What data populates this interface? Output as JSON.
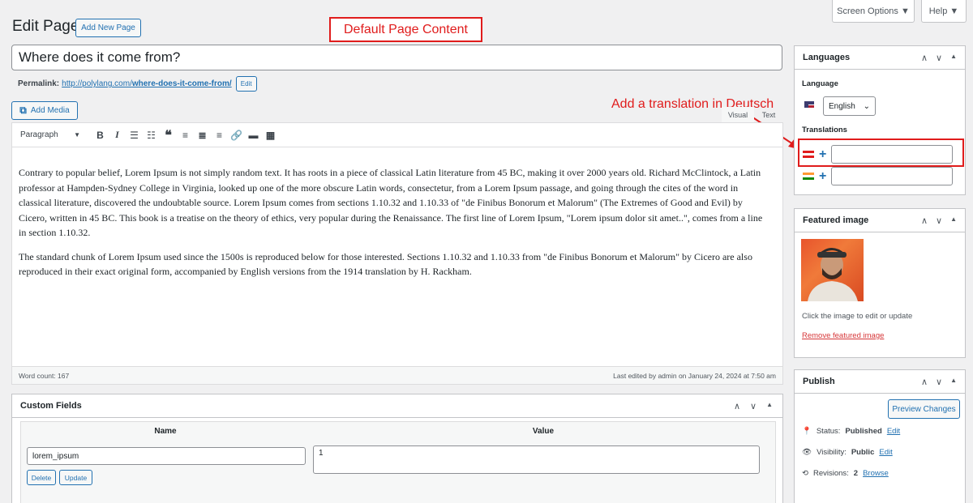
{
  "header": {
    "title": "Edit Page",
    "add_new_label": "Add New Page",
    "screen_options_label": "Screen Options ▼",
    "help_label": "Help ▼"
  },
  "annotations": {
    "default_content": "Default Page Content",
    "add_translation": "Add a translation in Deutsch"
  },
  "post": {
    "title": "Where does it come from?",
    "permalink_label": "Permalink:",
    "permalink_base": "http://polylang.com/",
    "permalink_slug": "where-does-it-come-from/",
    "permalink_edit": "Edit"
  },
  "editor": {
    "add_media_label": "Add Media",
    "tab_visual": "Visual",
    "tab_text": "Text",
    "format_select": "Paragraph",
    "toolbar_icons": [
      "bold-icon",
      "italic-icon",
      "bullet-list-icon",
      "numbered-list-icon",
      "blockquote-icon",
      "align-left-icon",
      "align-center-icon",
      "align-right-icon",
      "link-icon",
      "read-more-icon",
      "toolbar-toggle-icon"
    ],
    "paragraphs": [
      "Contrary to popular belief, Lorem Ipsum is not simply random text. It has roots in a piece of classical Latin literature from 45 BC, making it over 2000 years old. Richard McClintock, a Latin professor at Hampden-Sydney College in Virginia, looked up one of the more obscure Latin words, consectetur, from a Lorem Ipsum passage, and going through the cites of the word in classical literature, discovered the undoubtable source. Lorem Ipsum comes from sections 1.10.32 and 1.10.33 of \"de Finibus Bonorum et Malorum\" (The Extremes of Good and Evil) by Cicero, written in 45 BC. This book is a treatise on the theory of ethics, very popular during the Renaissance. The first line of Lorem Ipsum, \"Lorem ipsum dolor sit amet..\", comes from a line in section 1.10.32.",
      "The standard chunk of Lorem Ipsum used since the 1500s is reproduced below for those interested. Sections 1.10.32 and 1.10.33 from \"de Finibus Bonorum et Malorum\" by Cicero are also reproduced in their exact original form, accompanied by English versions from the 1914 translation by H. Rackham."
    ],
    "word_count": "Word count: 167",
    "last_edited": "Last edited by admin on January 24, 2024 at 7:50 am"
  },
  "custom_fields": {
    "title": "Custom Fields",
    "col_name": "Name",
    "col_value": "Value",
    "name_value": "lorem_ipsum",
    "value_value": "1",
    "delete_label": "Delete",
    "update_label": "Update"
  },
  "languages": {
    "title": "Languages",
    "language_label": "Language",
    "selected_language": "English",
    "translations_label": "Translations"
  },
  "featured_image": {
    "title": "Featured image",
    "help_text": "Click the image to edit or update",
    "remove_link": "Remove featured image"
  },
  "publish": {
    "title": "Publish",
    "preview_label": "Preview Changes",
    "status_label": "Status:",
    "status_value": "Published",
    "visibility_label": "Visibility:",
    "visibility_value": "Public",
    "revisions_label": "Revisions:",
    "revisions_value": "2",
    "edit_link": "Edit",
    "browse_link": "Browse"
  },
  "colors": {
    "accent": "#2271b1",
    "annotation": "#e01c1c"
  }
}
